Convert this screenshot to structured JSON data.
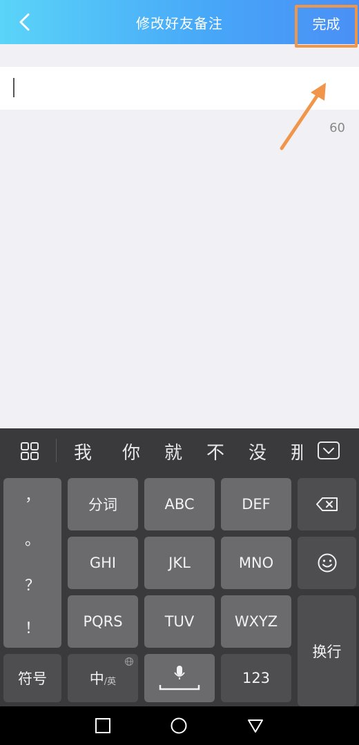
{
  "header": {
    "title": "修改好友备注",
    "done_label": "完成",
    "back_icon": "chevron-left-icon"
  },
  "input": {
    "value": "",
    "char_limit": "60"
  },
  "annotation": {
    "arrow_color": "#f0954a",
    "highlight_color": "#f0954a"
  },
  "keyboard": {
    "candidates": [
      "我",
      "你",
      "就",
      "不",
      "没",
      "那"
    ],
    "punctuation": [
      "，",
      "。",
      "？",
      "！"
    ],
    "keys": {
      "fenci": "分词",
      "abc": "ABC",
      "def": "DEF",
      "ghi": "GHI",
      "jkl": "JKL",
      "mno": "MNO",
      "pqrs": "PQRS",
      "tuv": "TUV",
      "wxyz": "WXYZ",
      "symbols": "符号",
      "zh": "中",
      "en": "/英",
      "num": "123",
      "newline": "换行"
    }
  },
  "colors": {
    "header_gradient_start": "#5ad4f8",
    "header_gradient_end": "#4a8ff5",
    "keyboard_bg": "#3a3a3c",
    "key_bg": "#6b6b6d",
    "key_dark_bg": "#4e4e50"
  }
}
